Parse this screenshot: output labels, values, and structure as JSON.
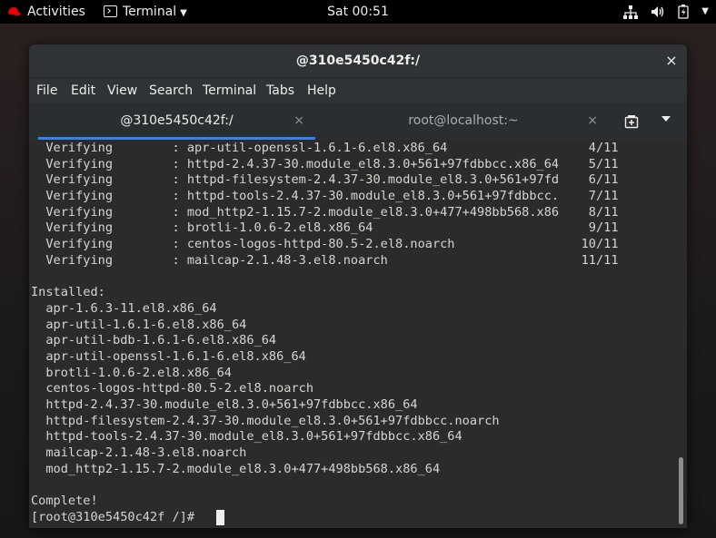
{
  "topbar": {
    "activities": "Activities",
    "app_name": "Terminal",
    "clock": "Sat 00:51"
  },
  "window": {
    "title": "@310e5450c42f:/",
    "close_glyph": "×"
  },
  "menu": [
    "File",
    "Edit",
    "View",
    "Search",
    "Terminal",
    "Tabs",
    "Help"
  ],
  "tabs": [
    {
      "label": "@310e5450c42f:/",
      "close": "×",
      "active": true
    },
    {
      "label": "root@localhost:~",
      "close": "×",
      "active": false
    }
  ],
  "icons": {
    "logo": "redhat-logo",
    "app": "terminal-icon",
    "network": "network-icon",
    "volume": "volume-icon",
    "battery": "battery-icon",
    "new_tab": "new-tab-icon"
  },
  "colors": {
    "accent": "#3584e4",
    "terminal_bg": "#2b2b2b",
    "terminal_fg": "#d3d7cf",
    "titlebar": "#2f3335"
  },
  "terminal": {
    "verifying": [
      {
        "status": "Verifying",
        "package": "apr-util-openssl-1.6.1-6.el8.x86_64",
        "progress": "4/11"
      },
      {
        "status": "Verifying",
        "package": "httpd-2.4.37-30.module_el8.3.0+561+97fdbbcc.x86_64",
        "progress": "5/11"
      },
      {
        "status": "Verifying",
        "package": "httpd-filesystem-2.4.37-30.module_el8.3.0+561+97fd",
        "progress": "6/11"
      },
      {
        "status": "Verifying",
        "package": "httpd-tools-2.4.37-30.module_el8.3.0+561+97fdbbcc.",
        "progress": "7/11"
      },
      {
        "status": "Verifying",
        "package": "mod_http2-1.15.7-2.module_el8.3.0+477+498bb568.x86",
        "progress": "8/11"
      },
      {
        "status": "Verifying",
        "package": "brotli-1.0.6-2.el8.x86_64",
        "progress": "9/11"
      },
      {
        "status": "Verifying",
        "package": "centos-logos-httpd-80.5-2.el8.noarch",
        "progress": "10/11"
      },
      {
        "status": "Verifying",
        "package": "mailcap-2.1.48-3.el8.noarch",
        "progress": "11/11"
      }
    ],
    "installed_header": "Installed:",
    "installed": [
      "apr-1.6.3-11.el8.x86_64",
      "apr-util-1.6.1-6.el8.x86_64",
      "apr-util-bdb-1.6.1-6.el8.x86_64",
      "apr-util-openssl-1.6.1-6.el8.x86_64",
      "brotli-1.0.6-2.el8.x86_64",
      "centos-logos-httpd-80.5-2.el8.noarch",
      "httpd-2.4.37-30.module_el8.3.0+561+97fdbbcc.x86_64",
      "httpd-filesystem-2.4.37-30.module_el8.3.0+561+97fdbbcc.noarch",
      "httpd-tools-2.4.37-30.module_el8.3.0+561+97fdbbcc.x86_64",
      "mailcap-2.1.48-3.el8.noarch",
      "mod_http2-1.15.7-2.module_el8.3.0+477+498bb568.x86_64"
    ],
    "complete": "Complete!",
    "prompt": "[root@310e5450c42f /]# "
  }
}
